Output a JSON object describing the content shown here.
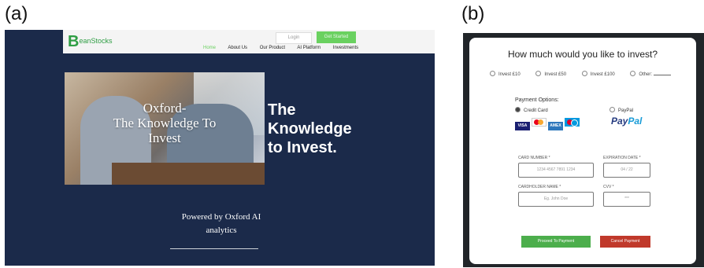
{
  "panel_a": {
    "label": "(a)",
    "logo_mark": "B",
    "logo_text": "eanStocks",
    "login": "Login",
    "get_started": "Get Started",
    "nav": [
      "Home",
      "About Us",
      "Our Product",
      "AI Platform",
      "Investments"
    ],
    "photo_caption_line1": "Oxford-",
    "photo_caption_line2": "The Knowledge To",
    "photo_caption_line3": "Invest",
    "hero_line1": "The",
    "hero_line2": "Knowledge",
    "hero_line3": "to Invest.",
    "powered_line1": "Powered by Oxford AI",
    "powered_line2": "analytics"
  },
  "panel_b": {
    "label": "(b)",
    "question": "How much would you like to invest?",
    "invest_options": [
      "Invest £10",
      "Invest £50",
      "Invest £100",
      "Other:"
    ],
    "payment_title": "Payment Options:",
    "credit_card": "Credit Card",
    "paypal": "PayPal",
    "card_logos": [
      {
        "name": "VISA",
        "color": "#1a1f71"
      },
      {
        "name": "MC",
        "color": "#eb001b"
      },
      {
        "name": "AMEX",
        "color": "#2e77bc"
      },
      {
        "name": "MAESTRO",
        "color": "#0099df"
      }
    ],
    "paypal_logo_a": "Pay",
    "paypal_logo_b": "Pal",
    "card_number_label": "CARD NUMBER *",
    "card_number_placeholder": "1234 4567 7891 1234",
    "expiration_label": "EXPIRATION DATE *",
    "expiration_placeholder": "04 / 22",
    "cardholder_label": "CARDHOLDER NAME *",
    "cardholder_placeholder": "Eg. John Doe",
    "cvv_label": "CVV *",
    "cvv_placeholder": "***",
    "proceed": "Proceed To Payment",
    "cancel": "Cancel Payment"
  }
}
